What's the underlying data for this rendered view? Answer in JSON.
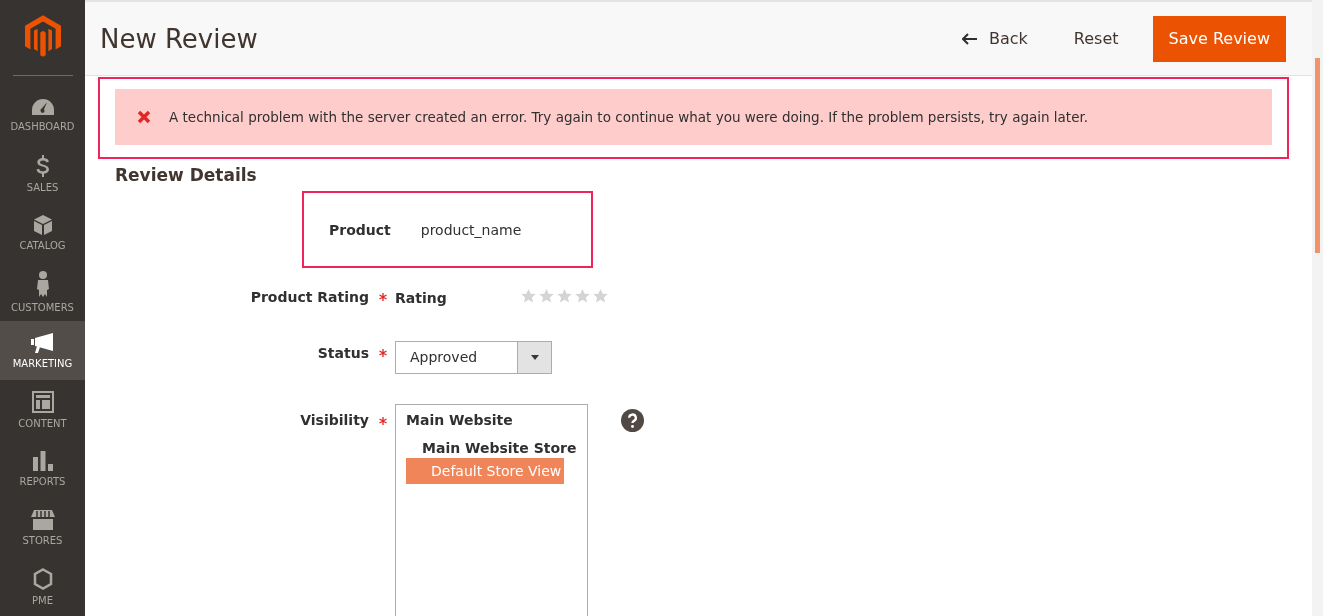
{
  "sidebar": {
    "items": [
      {
        "label": "DASHBOARD",
        "selected": false
      },
      {
        "label": "SALES",
        "selected": false
      },
      {
        "label": "CATALOG",
        "selected": false
      },
      {
        "label": "CUSTOMERS",
        "selected": false
      },
      {
        "label": "MARKETING",
        "selected": true
      },
      {
        "label": "CONTENT",
        "selected": false
      },
      {
        "label": "REPORTS",
        "selected": false
      },
      {
        "label": "STORES",
        "selected": false
      },
      {
        "label": "PME",
        "selected": false
      }
    ]
  },
  "header": {
    "title": "New Review",
    "back": "Back",
    "reset": "Reset",
    "save": "Save Review"
  },
  "error": {
    "message": "A technical problem with the server created an error. Try again to continue what you were doing. If the problem persists, try again later."
  },
  "section": {
    "title": "Review Details"
  },
  "form": {
    "product": {
      "label": "Product",
      "value": "product_name"
    },
    "rating": {
      "label": "Product Rating",
      "sub_label": "Rating",
      "stars": 0
    },
    "status": {
      "label": "Status",
      "value": "Approved"
    },
    "visibility": {
      "label": "Visibility",
      "website": "Main Website",
      "store": "Main Website Store",
      "views": [
        {
          "label": "Default Store View",
          "selected": true
        }
      ]
    }
  }
}
